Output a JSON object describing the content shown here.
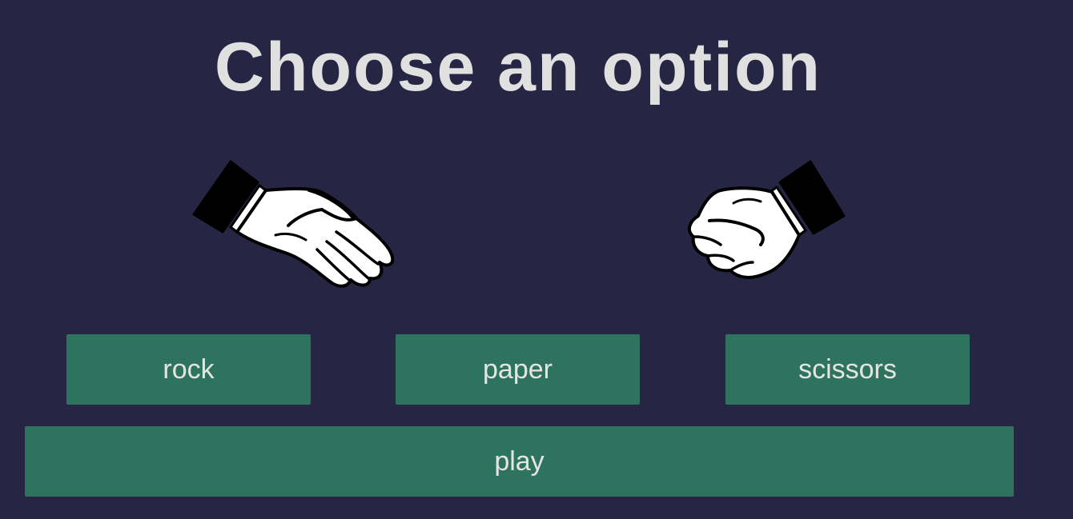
{
  "title": "Choose an option",
  "hands": {
    "player_icon": "open-hand-icon",
    "computer_icon": "fist-icon"
  },
  "choices": {
    "rock_label": "rock",
    "paper_label": "paper",
    "scissors_label": "scissors"
  },
  "play_label": "play",
  "colors": {
    "background": "#262644",
    "button": "#2e735e",
    "button_text": "#e4e4e4",
    "title_text": "#e0e0e0"
  }
}
